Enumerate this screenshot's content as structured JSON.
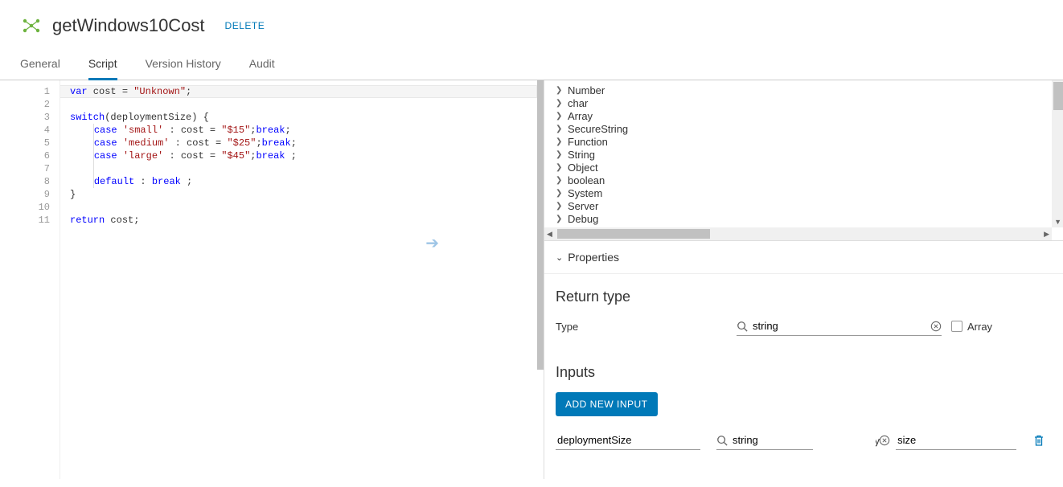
{
  "header": {
    "title": "getWindows10Cost",
    "delete": "DELETE"
  },
  "tabs": {
    "general": "General",
    "script": "Script",
    "version_history": "Version History",
    "audit": "Audit"
  },
  "editor": {
    "lines": [
      {
        "n": "1",
        "html": "<span class='kw'>var</span> cost = <span class='str'>\"Unknown\"</span>;"
      },
      {
        "n": "2",
        "html": ""
      },
      {
        "n": "3",
        "html": "<span class='kw'>switch</span>(deploymentSize) {"
      },
      {
        "n": "4",
        "html": "    <span class='ind'></span><span class='kw'>case</span> <span class='str'>'small'</span> : cost = <span class='str'>\"$15\"</span>;<span class='kw'>break</span>;"
      },
      {
        "n": "5",
        "html": "    <span class='ind'></span><span class='kw'>case</span> <span class='str'>'medium'</span> : cost = <span class='str'>\"$25\"</span>;<span class='kw'>break</span>;"
      },
      {
        "n": "6",
        "html": "    <span class='ind'></span><span class='kw'>case</span> <span class='str'>'large'</span> : cost = <span class='str'>\"$45\"</span>;<span class='kw'>break</span> ;"
      },
      {
        "n": "7",
        "html": "    <span class='ind'></span>"
      },
      {
        "n": "8",
        "html": "    <span class='ind'></span><span class='kw'>default</span> : <span class='kw'>break</span> ;"
      },
      {
        "n": "9",
        "html": "}"
      },
      {
        "n": "10",
        "html": ""
      },
      {
        "n": "11",
        "html": "<span class='kw'>return</span> cost;"
      }
    ]
  },
  "tree": {
    "items": [
      "Number",
      "char",
      "Array",
      "SecureString",
      "Function",
      "String",
      "Object",
      "boolean",
      "System",
      "Server",
      "Debug"
    ]
  },
  "props": {
    "header": "Properties",
    "return_section": "Return type",
    "type_label": "Type",
    "type_value": "string",
    "array_label": "Array",
    "inputs_section": "Inputs",
    "add_button": "ADD NEW INPUT",
    "input0": {
      "name": "deploymentSize",
      "type": "string",
      "desc": "size"
    }
  }
}
